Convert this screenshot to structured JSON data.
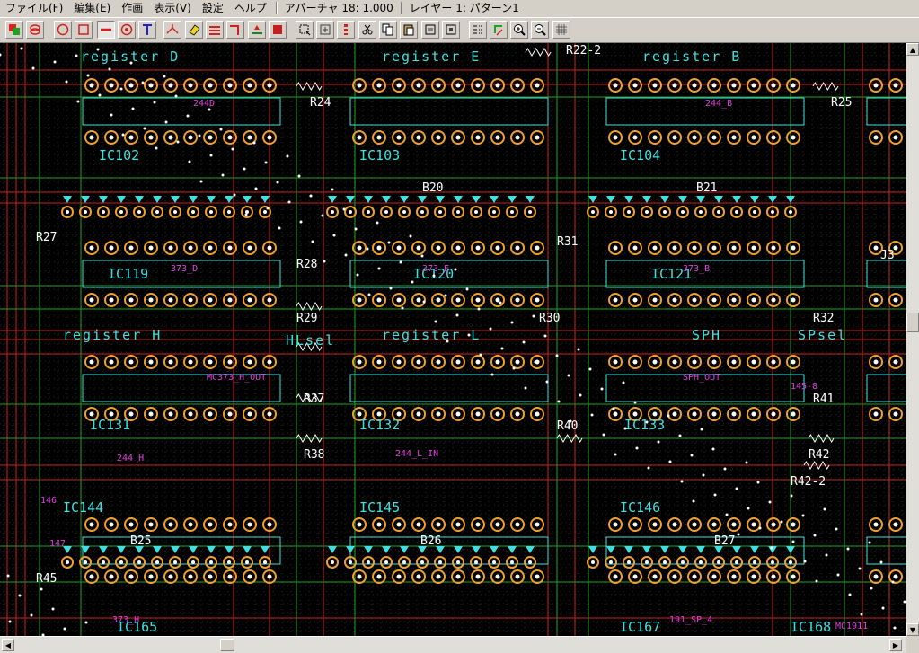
{
  "menu": {
    "items": [
      {
        "label": "ファイル(F)"
      },
      {
        "label": "編集(E)"
      },
      {
        "label": "作画"
      },
      {
        "label": "表示(V)"
      },
      {
        "label": "設定"
      },
      {
        "label": "ヘルプ"
      }
    ],
    "aperture": "アパーチャ 18: 1.000",
    "layer": "レイヤー 1: パターン1"
  },
  "toolbar": {
    "tools": [
      {
        "name": "layer-color-icon"
      },
      {
        "name": "pad-stack-icon"
      },
      {
        "name": "circle-icon"
      },
      {
        "name": "rectangle-icon"
      },
      {
        "name": "line-icon"
      },
      {
        "name": "target-pad-icon"
      },
      {
        "name": "text-tool-icon"
      },
      {
        "name": "junction-icon"
      },
      {
        "name": "eraser-icon"
      },
      {
        "name": "bus-icon"
      },
      {
        "name": "corner-icon"
      },
      {
        "name": "via-icon"
      },
      {
        "name": "fill-area-icon"
      },
      {
        "name": "select-area-icon"
      },
      {
        "name": "move-icon"
      },
      {
        "name": "align-icon"
      },
      {
        "name": "cut-icon"
      },
      {
        "name": "copy-icon"
      },
      {
        "name": "paste-icon"
      },
      {
        "name": "group-icon"
      },
      {
        "name": "ungroup-icon"
      },
      {
        "name": "mirror-icon"
      },
      {
        "name": "rotate-icon"
      },
      {
        "name": "zoom-in-icon"
      },
      {
        "name": "zoom-out-icon"
      },
      {
        "name": "grid-icon"
      }
    ]
  },
  "board": {
    "colors": {
      "background": "#000000",
      "grid": "#3a5a3a",
      "trace_red": "#d02020",
      "trace_green": "#20a020",
      "silk_cyan": "#40e0e0",
      "pad_orange": "#f0a030",
      "label_magenta": "#e040e0",
      "label_white": "#ffffff"
    },
    "section_labels": [
      "register D",
      "register E",
      "register B",
      "register H",
      "register L",
      "SPH",
      "SPsel",
      "HLsel"
    ],
    "ic_labels": [
      "IC102",
      "IC103",
      "IC104",
      "IC119",
      "IC120",
      "IC121",
      "IC131",
      "IC132",
      "IC133",
      "IC144",
      "IC145",
      "IC146",
      "IC165",
      "IC167",
      "IC168"
    ],
    "resistor_labels": [
      "R22-2",
      "R24",
      "R25",
      "R27",
      "R28",
      "R29",
      "R30",
      "R31",
      "R32",
      "R37",
      "R38",
      "R40",
      "R41",
      "R42",
      "R42-2",
      "R45",
      "B20",
      "B21",
      "B25",
      "B26",
      "B27",
      "J3"
    ],
    "net_labels": [
      "373_D",
      "373_E",
      "373_B",
      "373_H",
      "244D",
      "244_B",
      "244_H",
      "MC373_H_OUT",
      "SPH_OUT",
      "244_L_IN",
      "145-8",
      "146",
      "147",
      "191_SP_4",
      "MC1911"
    ]
  }
}
